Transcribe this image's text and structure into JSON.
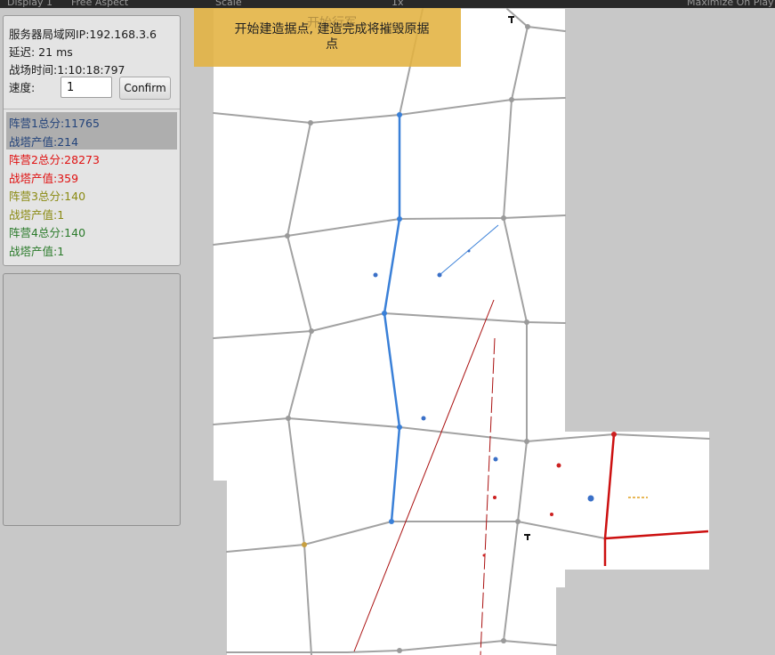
{
  "topbar": {
    "display": "Display 1",
    "aspect": "Free Aspect",
    "scale": "Scale",
    "scale_value": "1x",
    "maximize": "Maximize On Play"
  },
  "info": {
    "server_ip": "服务器局域网IP:192.168.3.6",
    "latency": "延迟: 21 ms",
    "battle_time": "战场时间:1:10:18:797",
    "speed_label": "速度:",
    "speed_value": "1",
    "confirm_label": "Confirm"
  },
  "scores": [
    {
      "total": "阵营1总分:11765",
      "tower": "战塔产值:214",
      "color": "#23437a"
    },
    {
      "total": "阵营2总分:28273",
      "tower": "战塔产值:359",
      "color": "#e01010"
    },
    {
      "total": "阵营3总分:140",
      "tower": "战塔产值:1",
      "color": "#8a8a12"
    },
    {
      "total": "阵营4总分:140",
      "tower": "战塔产值:1",
      "color": "#2a7a2a"
    }
  ],
  "toast": {
    "ghost_text": "开始行军",
    "message": "开始建造据点, 建造完成将摧毁原据点"
  },
  "colors": {
    "team1": "#3a80d8",
    "team2": "#cc1010",
    "grid": "#a4a4a4",
    "toast": "#e2b240"
  }
}
